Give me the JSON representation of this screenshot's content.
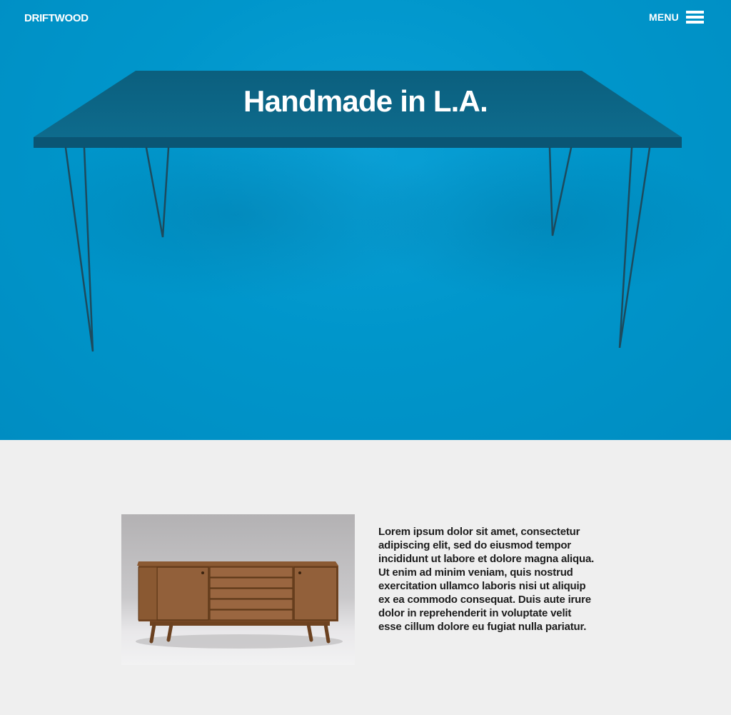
{
  "header": {
    "brand": "DRIFTWOOD",
    "menu_label": "MENU",
    "menu_icon": "hamburger-icon"
  },
  "hero": {
    "title": "Handmade in L.A.",
    "background_color": "#0096cb",
    "image": "table-photo"
  },
  "feature": {
    "image": "sideboard-photo",
    "text": "Lorem ipsum dolor sit amet, consectetur\nadipiscing elit, sed do eiusmod tempor\nincididunt ut labore et dolore magna aliqua.\nUt enim ad minim veniam, quis nostrud\nexercitation ullamco laboris nisi ut aliquip\nex ea commodo consequat. Duis aute irure\ndolor in reprehenderit in voluptate velit\nesse cillum dolore eu fugiat nulla pariatur."
  },
  "colors": {
    "hero_blue": "#0096cb",
    "page_background": "#efefef",
    "text_dark": "#1d1d1d",
    "white": "#ffffff"
  }
}
